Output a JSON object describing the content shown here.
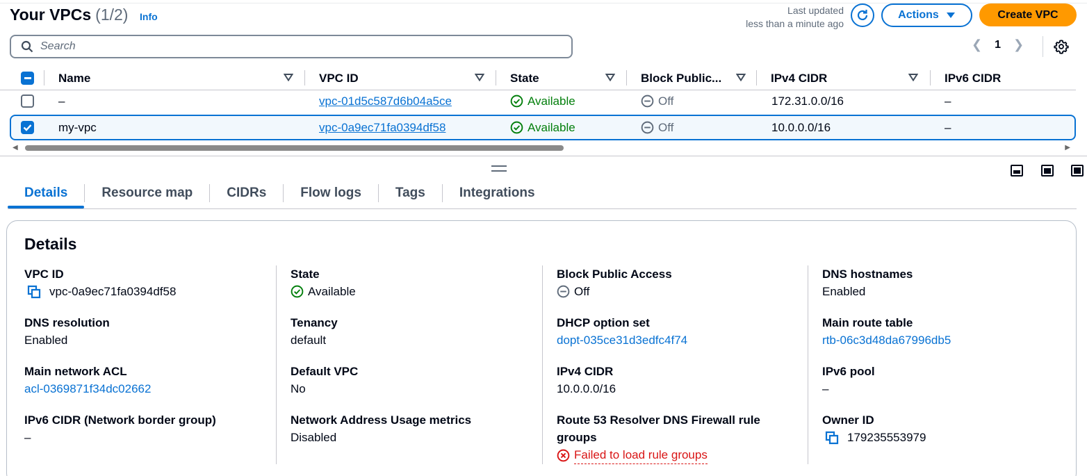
{
  "header": {
    "title": "Your VPCs",
    "count": "(1/2)",
    "info": "Info",
    "last_updated_line1": "Last updated",
    "last_updated_line2": "less than a minute ago",
    "actions_label": "Actions",
    "create_label": "Create VPC"
  },
  "search": {
    "placeholder": "Search"
  },
  "pagination": {
    "page": "1"
  },
  "table": {
    "columns": [
      "Name",
      "VPC ID",
      "State",
      "Block Public...",
      "IPv4 CIDR",
      "IPv6 CIDR"
    ],
    "rows": [
      {
        "selected": false,
        "name": "–",
        "vpc_id": "vpc-01d5c587d6b04a5ce",
        "state": "Available",
        "block": "Off",
        "ipv4": "172.31.0.0/16",
        "ipv6": "–"
      },
      {
        "selected": true,
        "name": "my-vpc",
        "vpc_id": "vpc-0a9ec71fa0394df58",
        "state": "Available",
        "block": "Off",
        "ipv4": "10.0.0.0/16",
        "ipv6": "–"
      }
    ]
  },
  "tabs": [
    "Details",
    "Resource map",
    "CIDRs",
    "Flow logs",
    "Tags",
    "Integrations"
  ],
  "details": {
    "title": "Details",
    "vpc_id": {
      "label": "VPC ID",
      "value": "vpc-0a9ec71fa0394df58"
    },
    "state": {
      "label": "State",
      "value": "Available"
    },
    "block_public_access": {
      "label": "Block Public Access",
      "value": "Off"
    },
    "dns_hostnames": {
      "label": "DNS hostnames",
      "value": "Enabled"
    },
    "dns_resolution": {
      "label": "DNS resolution",
      "value": "Enabled"
    },
    "tenancy": {
      "label": "Tenancy",
      "value": "default"
    },
    "dhcp_option_set": {
      "label": "DHCP option set",
      "value": "dopt-035ce31d3edfc4f74"
    },
    "main_route_table": {
      "label": "Main route table",
      "value": "rtb-06c3d48da67996db5"
    },
    "main_network_acl": {
      "label": "Main network ACL",
      "value": "acl-0369871f34dc02662"
    },
    "default_vpc": {
      "label": "Default VPC",
      "value": "No"
    },
    "ipv4_cidr": {
      "label": "IPv4 CIDR",
      "value": "10.0.0.0/16"
    },
    "ipv6_pool": {
      "label": "IPv6 pool",
      "value": "–"
    },
    "ipv6_cidr_nbg": {
      "label": "IPv6 CIDR (Network border group)",
      "value": "–"
    },
    "nau_metrics": {
      "label": "Network Address Usage metrics",
      "value": "Disabled"
    },
    "r53_firewall": {
      "label_line1": "Route 53 Resolver DNS Firewall rule",
      "label_line2": "groups",
      "value": "Failed to load rule groups"
    },
    "owner_id": {
      "label": "Owner ID",
      "value": "179235553979"
    }
  },
  "colors": {
    "accent": "#0972d3",
    "primary_button": "#ff9900",
    "success": "#037f0c",
    "error": "#d91515"
  }
}
